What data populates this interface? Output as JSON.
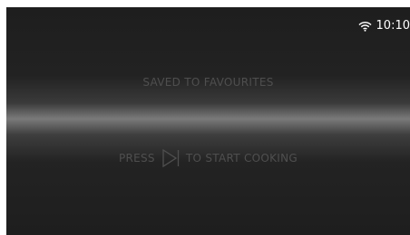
{
  "status_bar": {
    "wifi_icon": "wifi-icon",
    "time": "10:10"
  },
  "messages": {
    "saved": "SAVED TO FAVOURITES",
    "press_prefix": "PRESS",
    "play_icon": "play-icon",
    "press_suffix": "TO START COOKING"
  },
  "colors": {
    "background": "#1e1e1e",
    "highlight_band": "#7a7a7a",
    "message_text": "#4f4f4f",
    "status_text": "#ffffff"
  }
}
